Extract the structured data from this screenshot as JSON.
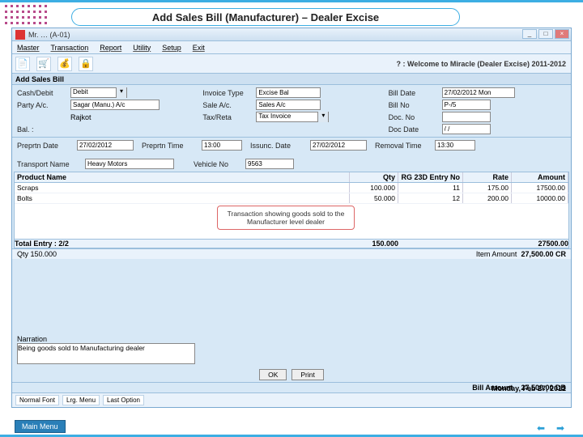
{
  "slide_title": "Add Sales Bill (Manufacturer) – Dealer Excise",
  "window_title": "Mr. … (A-01)",
  "menu": [
    "Master",
    "Transaction",
    "Report",
    "Utility",
    "Setup",
    "Exit"
  ],
  "welcome": "? : Welcome to Miracle (Dealer Excise) 2011-2012",
  "subheader": "Add Sales Bill",
  "form": {
    "cash_debit_label": "Cash/Debit",
    "cash_debit": "Debit",
    "invoice_type_label": "Invoice Type",
    "invoice_type": "Excise Bal",
    "bill_date_label": "Bill Date",
    "bill_date": "27/02/2012 Mon",
    "party_label": "Party A/c.",
    "party": "Sagar (Manu.) A/c",
    "sale_ac_label": "Sale A/c.",
    "sale_ac": "Sales A/c",
    "bill_no_label": "Bill No",
    "bill_no": "P-/5",
    "tax_label": "Tax/Reta",
    "tax": "Tax Invoice",
    "doc_no_label": "Doc. No",
    "doc_no": "",
    "doc_date_label": "Doc Date",
    "doc_date": "/ /",
    "city": "Rajkot",
    "balance_label": "Bal. :",
    "prep_date_label": "Preprtn Date",
    "prep_date": "27/02/2012",
    "prep_time_label": "Preprtn Time",
    "prep_time": "13:00",
    "issue_date_label": "Issunc. Date",
    "issue_date": "27/02/2012",
    "removal_time_label": "Removal Time",
    "removal_time": "13:30",
    "transport_label": "Transport Name",
    "transport": "Heavy Motors",
    "vehicle_label": "Vehicle No",
    "vehicle": "9563"
  },
  "grid": {
    "headers": {
      "product": "Product Name",
      "qty": "Qty",
      "rg": "RG 23D Entry No",
      "rate": "Rate",
      "amount": "Amount"
    },
    "rows": [
      {
        "product": "Scraps",
        "qty": "100.000",
        "rg": "11",
        "rate": "175.00",
        "amount": "17500.00"
      },
      {
        "product": "Bolts",
        "qty": "50.000",
        "rg": "12",
        "rate": "200.00",
        "amount": "10000.00"
      }
    ],
    "callout": "Transaction showing goods sold to the Manufacturer level dealer",
    "total_entry_label": "Total Entry : 2/2",
    "total_qty": "150.000",
    "total_amt": "27500.00"
  },
  "entry_qty_label": "Qty  150.000",
  "item_amount_label": "Item Amount",
  "item_amount": "27,500.00 CR",
  "narration_label": "Narration",
  "narration": "Being goods sold to Manufacturing dealer",
  "buttons": {
    "ok": "OK",
    "print": "Print"
  },
  "bill_amount_label": "Bill Amount",
  "bill_amount": "27,500.00 DB",
  "modes": [
    "Normal Font",
    "Lrg. Menu",
    "Last Option"
  ],
  "date_footer": "Monday, Feb 27, 2012",
  "main_menu": "Main Menu"
}
